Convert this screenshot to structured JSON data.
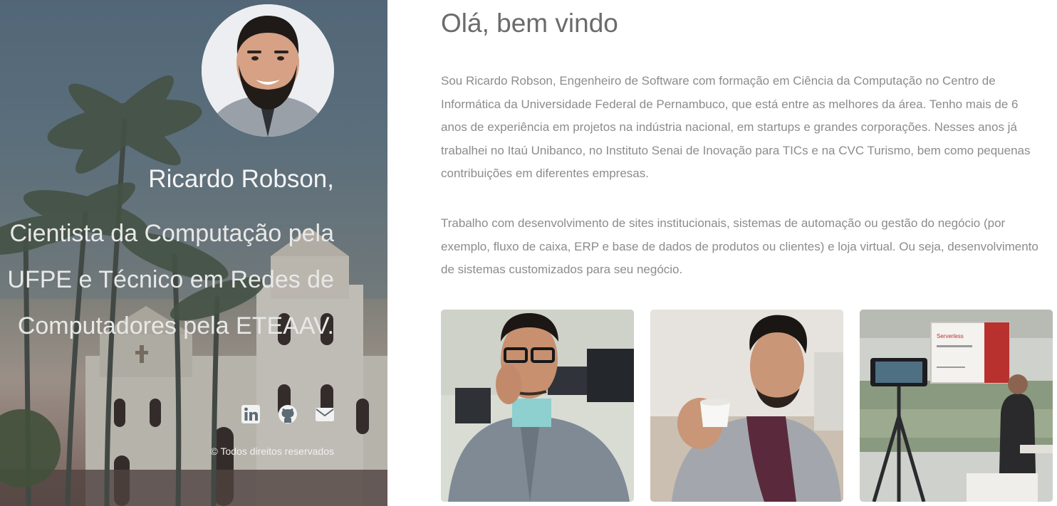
{
  "profile": {
    "name": "Ricardo Robson,",
    "tagline_lines": [
      "Cientista da Computação pela",
      "UFPE e Técnico em Redes de",
      "Computadores pela ETEAAV."
    ],
    "copyright": "© Todos direitos reservados"
  },
  "social": [
    {
      "icon": "linkedin-icon"
    },
    {
      "icon": "github-icon"
    },
    {
      "icon": "envelope-icon"
    }
  ],
  "main": {
    "greeting": "Olá, bem vindo",
    "paragraphs": [
      "Sou Ricardo Robson, Engenheiro de Software com formação em Ciência da Computação no Centro de Informática da Universidade Federal de Pernambuco, que está entre as melhores da área. Tenho mais de 6 anos de experiência em projetos na indústria nacional, em startups e grandes corporações. Nesses anos já trabalhei no Itaú Unibanco, no Instituto Senai de Inovação para TICs e na CVC Turismo, bem como pequenas contribuições em diferentes empresas.",
      "Trabalho com desenvolvimento de sites institucionais, sistemas de automação ou gestão do negócio (por exemplo, fluxo de caixa, ERP e base de dados de produtos ou clientes) e loja virtual. Ou seja, desenvolvimento de sistemas customizados para seu negócio."
    ]
  },
  "gallery": {
    "slide_title": "Serverless"
  },
  "colors": {
    "heading": "#6b6b6b",
    "body_text": "#8c8c8c",
    "hero_text": "#f4f4f4"
  }
}
